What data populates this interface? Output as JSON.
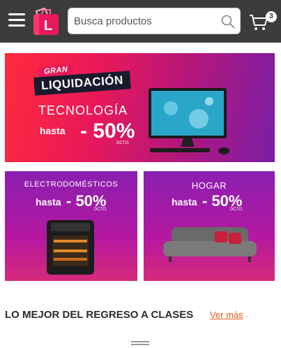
{
  "header": {
    "search_placeholder": "Busca productos",
    "cart_count": "3",
    "logo_letter": "L"
  },
  "banners": {
    "main": {
      "gran": "GRAN",
      "liquidacion": "LIQUIDACIÓN",
      "category": "TECNOLOGÍA",
      "hasta": "hasta",
      "discount": "- 50%",
      "dcto": "DCTO."
    },
    "electro": {
      "category": "ELECTRODOMÉSTICOS",
      "hasta": "hasta",
      "discount": "- 50%",
      "dcto": "DCTO."
    },
    "hogar": {
      "category": "HOGAR",
      "hasta": "hasta",
      "discount": "- 50%",
      "dcto": "DCTO."
    }
  },
  "section": {
    "title": "LO MEJOR DEL REGRESO A CLASES",
    "link": "Ver más"
  }
}
